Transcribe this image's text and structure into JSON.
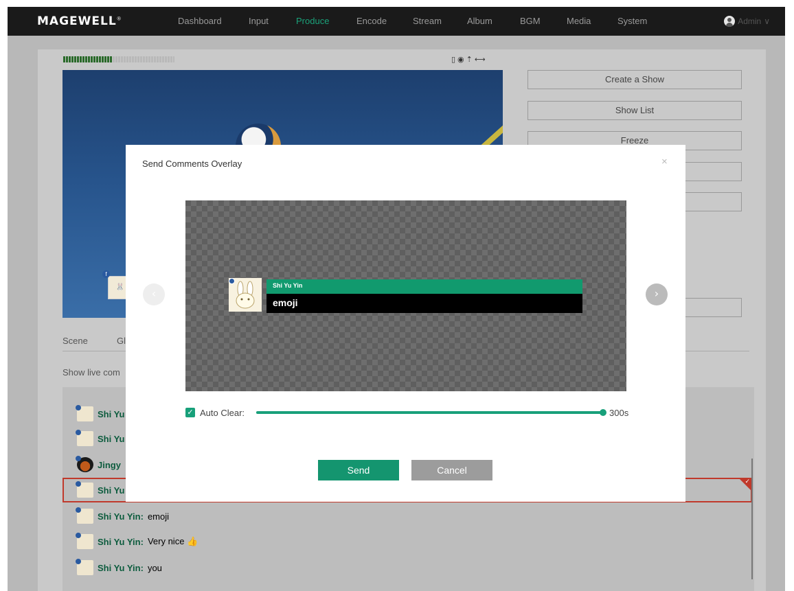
{
  "app": {
    "brand": "MAGEWELL",
    "brand_mark": "®"
  },
  "nav": {
    "items": [
      {
        "label": "Dashboard"
      },
      {
        "label": "Input"
      },
      {
        "label": "Produce"
      },
      {
        "label": "Encode"
      },
      {
        "label": "Stream"
      },
      {
        "label": "Album"
      },
      {
        "label": "BGM"
      },
      {
        "label": "Media"
      },
      {
        "label": "System"
      }
    ],
    "active": "Produce",
    "user": "Admin",
    "user_chevron": "∨"
  },
  "status_icons": "▯◉⇡⟷",
  "side_buttons": [
    "Create a Show",
    "Show List",
    "Freeze",
    "",
    "",
    ""
  ],
  "tabs": [
    "Scene",
    "Gl"
  ],
  "show_live_label": "Show live com",
  "comments": [
    {
      "name": "Shi Yu",
      "text": "",
      "avatar": "rabbit"
    },
    {
      "name": "Shi Yu",
      "text": "",
      "avatar": "rabbit"
    },
    {
      "name": "Jingy",
      "text": "",
      "avatar": "photo"
    },
    {
      "name": "Shi Yu",
      "text": "",
      "avatar": "rabbit",
      "selected": true
    },
    {
      "name": "Shi Yu Yin:",
      "text": "emoji",
      "avatar": "rabbit"
    },
    {
      "name": "Shi Yu Yin:",
      "text": "Very nice 👍",
      "avatar": "rabbit"
    },
    {
      "name": "Shi Yu Yin:",
      "text": "you",
      "avatar": "rabbit"
    }
  ],
  "modal": {
    "title": "Send Comments Overlay",
    "close": "×",
    "overlay": {
      "name": "Shi Yu Yin",
      "text": "emoji"
    },
    "prev_arrow": "‹",
    "next_arrow": "›",
    "auto_clear": {
      "checked": true,
      "label": "Auto Clear:",
      "value": "300s",
      "fraction": 1.0
    },
    "send": "Send",
    "cancel": "Cancel"
  },
  "colors": {
    "accent": "#14956f",
    "nav_active": "#1aa27a",
    "selected_border": "#c0392b"
  },
  "icons": [
    "user-icon",
    "chevron-down-icon",
    "close-icon",
    "chevron-left-icon",
    "chevron-right-icon",
    "checkbox-icon",
    "thumbs-up-icon"
  ]
}
